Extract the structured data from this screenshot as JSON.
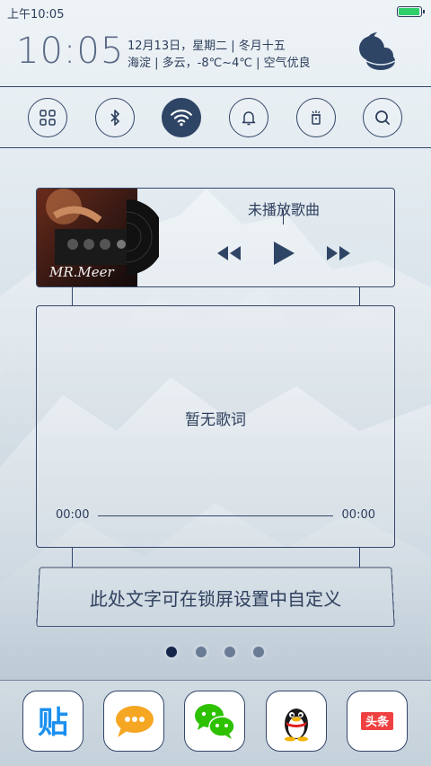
{
  "status_bar": {
    "time": "上午10:05",
    "battery_color": "#2fcf6a",
    "battery_level": 0.9
  },
  "header": {
    "clock": "10:05",
    "date_line": "12月13日，星期二 | 冬月十五",
    "weather_line": "海淀 | 多云，-8℃~4℃ | 空气优良",
    "weather_icon": "cloudy-night-icon"
  },
  "toggles": [
    {
      "icon": "apps-grid-icon",
      "active": false
    },
    {
      "icon": "bluetooth-icon",
      "active": false
    },
    {
      "icon": "wifi-icon",
      "active": true
    },
    {
      "icon": "bell-icon",
      "active": false
    },
    {
      "icon": "flashlight-icon",
      "active": false
    },
    {
      "icon": "search-icon",
      "active": false
    }
  ],
  "music": {
    "song_title": "未播放歌曲",
    "album_art_caption": "MR.Meer",
    "controls": [
      "previous-icon",
      "play-icon",
      "next-icon"
    ]
  },
  "lyrics": {
    "placeholder": "暂无歌词",
    "time_start": "00:00",
    "time_end": "00:00"
  },
  "custom_text": "此处文字可在锁屏设置中自定义",
  "pager": {
    "count": 4,
    "active_index": 0
  },
  "dock": [
    {
      "name": "tieba-app",
      "label": "贴",
      "color": "#1a8ff0"
    },
    {
      "name": "message-app",
      "color": "#f5a623"
    },
    {
      "name": "wechat-app",
      "color": "#2dc100"
    },
    {
      "name": "qq-app",
      "color": "#1a1a1a"
    },
    {
      "name": "toutiao-app",
      "label": "头条",
      "color": "#f04142"
    }
  ],
  "colors": {
    "ink": "#2c3e5c",
    "line": "#34466a",
    "active_toggle": "#2f4566"
  }
}
